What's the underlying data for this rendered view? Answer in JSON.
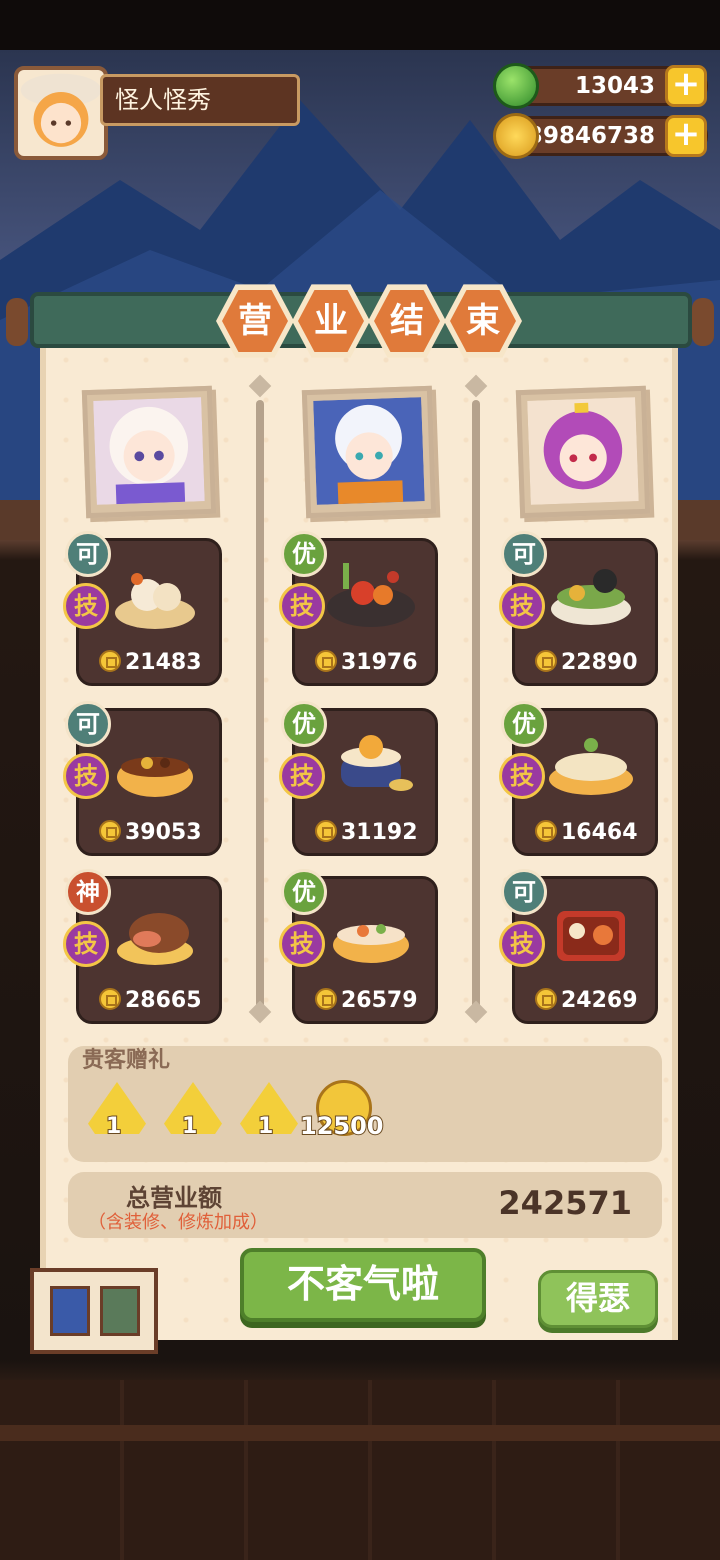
{
  "player": {
    "name": "怪人怪秀"
  },
  "resources": {
    "jade": {
      "value": "13043",
      "icon": "jade-icon",
      "plus": "+"
    },
    "coins": {
      "value": "39846738",
      "icon": "coin-icon",
      "plus": "+"
    }
  },
  "title": [
    "营",
    "业",
    "结",
    "束"
  ],
  "columns": [
    {
      "dishes": [
        {
          "grade": "可",
          "skill": "技",
          "price": "21483",
          "icon": "dumpling-basket-icon"
        },
        {
          "grade": "可",
          "skill": "技",
          "price": "39053",
          "icon": "stew-pot-icon"
        },
        {
          "grade": "神",
          "skill": "技",
          "price": "28665",
          "icon": "roast-duck-icon"
        }
      ]
    },
    {
      "dishes": [
        {
          "grade": "优",
          "skill": "技",
          "price": "31976",
          "icon": "hotpot-feast-icon"
        },
        {
          "grade": "优",
          "skill": "技",
          "price": "31192",
          "icon": "flower-cake-icon"
        },
        {
          "grade": "优",
          "skill": "技",
          "price": "26579",
          "icon": "seafood-soup-icon"
        }
      ]
    },
    {
      "dishes": [
        {
          "grade": "可",
          "skill": "技",
          "price": "22890",
          "icon": "salad-bowl-icon"
        },
        {
          "grade": "优",
          "skill": "技",
          "price": "16464",
          "icon": "dumpling-plate-icon"
        },
        {
          "grade": "可",
          "skill": "技",
          "price": "24269",
          "icon": "bento-box-icon"
        }
      ]
    }
  ],
  "gift": {
    "title": "贵客赠礼",
    "items": [
      {
        "count": "1",
        "icon": "yellow-talisman-icon"
      },
      {
        "count": "1",
        "icon": "yellow-talisman-icon"
      },
      {
        "count": "1",
        "icon": "yellow-talisman-icon"
      }
    ],
    "coins": "12500"
  },
  "total": {
    "label": "总营业额",
    "note": "（含装修、修炼加成）",
    "value": "242571"
  },
  "buttons": {
    "main": "不客气啦",
    "side": "得瑟"
  },
  "colors": {
    "grade_ke": "#4f7f78",
    "grade_you": "#6aa23e",
    "grade_shen": "#c9502f"
  }
}
